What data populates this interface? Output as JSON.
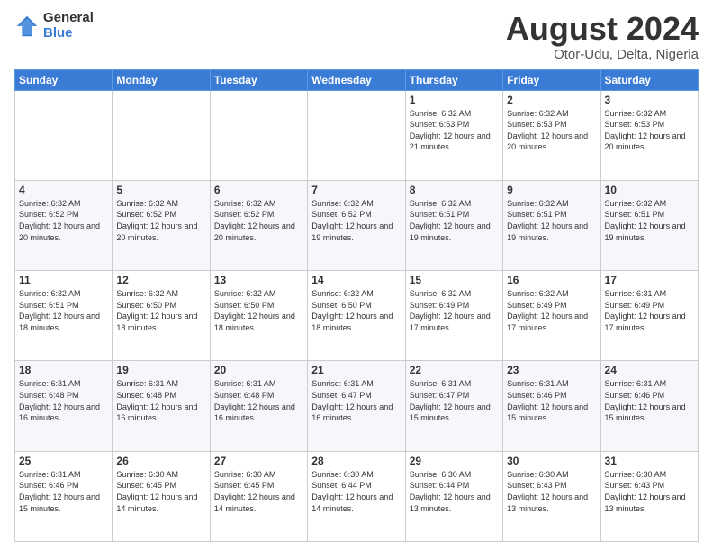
{
  "logo": {
    "general": "General",
    "blue": "Blue"
  },
  "header": {
    "month": "August 2024",
    "location": "Otor-Udu, Delta, Nigeria"
  },
  "days_of_week": [
    "Sunday",
    "Monday",
    "Tuesday",
    "Wednesday",
    "Thursday",
    "Friday",
    "Saturday"
  ],
  "weeks": [
    [
      {
        "day": "",
        "info": ""
      },
      {
        "day": "",
        "info": ""
      },
      {
        "day": "",
        "info": ""
      },
      {
        "day": "",
        "info": ""
      },
      {
        "day": "1",
        "info": "Sunrise: 6:32 AM\nSunset: 6:53 PM\nDaylight: 12 hours and 21 minutes."
      },
      {
        "day": "2",
        "info": "Sunrise: 6:32 AM\nSunset: 6:53 PM\nDaylight: 12 hours and 20 minutes."
      },
      {
        "day": "3",
        "info": "Sunrise: 6:32 AM\nSunset: 6:53 PM\nDaylight: 12 hours and 20 minutes."
      }
    ],
    [
      {
        "day": "4",
        "info": "Sunrise: 6:32 AM\nSunset: 6:52 PM\nDaylight: 12 hours and 20 minutes."
      },
      {
        "day": "5",
        "info": "Sunrise: 6:32 AM\nSunset: 6:52 PM\nDaylight: 12 hours and 20 minutes."
      },
      {
        "day": "6",
        "info": "Sunrise: 6:32 AM\nSunset: 6:52 PM\nDaylight: 12 hours and 20 minutes."
      },
      {
        "day": "7",
        "info": "Sunrise: 6:32 AM\nSunset: 6:52 PM\nDaylight: 12 hours and 19 minutes."
      },
      {
        "day": "8",
        "info": "Sunrise: 6:32 AM\nSunset: 6:51 PM\nDaylight: 12 hours and 19 minutes."
      },
      {
        "day": "9",
        "info": "Sunrise: 6:32 AM\nSunset: 6:51 PM\nDaylight: 12 hours and 19 minutes."
      },
      {
        "day": "10",
        "info": "Sunrise: 6:32 AM\nSunset: 6:51 PM\nDaylight: 12 hours and 19 minutes."
      }
    ],
    [
      {
        "day": "11",
        "info": "Sunrise: 6:32 AM\nSunset: 6:51 PM\nDaylight: 12 hours and 18 minutes."
      },
      {
        "day": "12",
        "info": "Sunrise: 6:32 AM\nSunset: 6:50 PM\nDaylight: 12 hours and 18 minutes."
      },
      {
        "day": "13",
        "info": "Sunrise: 6:32 AM\nSunset: 6:50 PM\nDaylight: 12 hours and 18 minutes."
      },
      {
        "day": "14",
        "info": "Sunrise: 6:32 AM\nSunset: 6:50 PM\nDaylight: 12 hours and 18 minutes."
      },
      {
        "day": "15",
        "info": "Sunrise: 6:32 AM\nSunset: 6:49 PM\nDaylight: 12 hours and 17 minutes."
      },
      {
        "day": "16",
        "info": "Sunrise: 6:32 AM\nSunset: 6:49 PM\nDaylight: 12 hours and 17 minutes."
      },
      {
        "day": "17",
        "info": "Sunrise: 6:31 AM\nSunset: 6:49 PM\nDaylight: 12 hours and 17 minutes."
      }
    ],
    [
      {
        "day": "18",
        "info": "Sunrise: 6:31 AM\nSunset: 6:48 PM\nDaylight: 12 hours and 16 minutes."
      },
      {
        "day": "19",
        "info": "Sunrise: 6:31 AM\nSunset: 6:48 PM\nDaylight: 12 hours and 16 minutes."
      },
      {
        "day": "20",
        "info": "Sunrise: 6:31 AM\nSunset: 6:48 PM\nDaylight: 12 hours and 16 minutes."
      },
      {
        "day": "21",
        "info": "Sunrise: 6:31 AM\nSunset: 6:47 PM\nDaylight: 12 hours and 16 minutes."
      },
      {
        "day": "22",
        "info": "Sunrise: 6:31 AM\nSunset: 6:47 PM\nDaylight: 12 hours and 15 minutes."
      },
      {
        "day": "23",
        "info": "Sunrise: 6:31 AM\nSunset: 6:46 PM\nDaylight: 12 hours and 15 minutes."
      },
      {
        "day": "24",
        "info": "Sunrise: 6:31 AM\nSunset: 6:46 PM\nDaylight: 12 hours and 15 minutes."
      }
    ],
    [
      {
        "day": "25",
        "info": "Sunrise: 6:31 AM\nSunset: 6:46 PM\nDaylight: 12 hours and 15 minutes."
      },
      {
        "day": "26",
        "info": "Sunrise: 6:30 AM\nSunset: 6:45 PM\nDaylight: 12 hours and 14 minutes."
      },
      {
        "day": "27",
        "info": "Sunrise: 6:30 AM\nSunset: 6:45 PM\nDaylight: 12 hours and 14 minutes."
      },
      {
        "day": "28",
        "info": "Sunrise: 6:30 AM\nSunset: 6:44 PM\nDaylight: 12 hours and 14 minutes."
      },
      {
        "day": "29",
        "info": "Sunrise: 6:30 AM\nSunset: 6:44 PM\nDaylight: 12 hours and 13 minutes."
      },
      {
        "day": "30",
        "info": "Sunrise: 6:30 AM\nSunset: 6:43 PM\nDaylight: 12 hours and 13 minutes."
      },
      {
        "day": "31",
        "info": "Sunrise: 6:30 AM\nSunset: 6:43 PM\nDaylight: 12 hours and 13 minutes."
      }
    ]
  ]
}
